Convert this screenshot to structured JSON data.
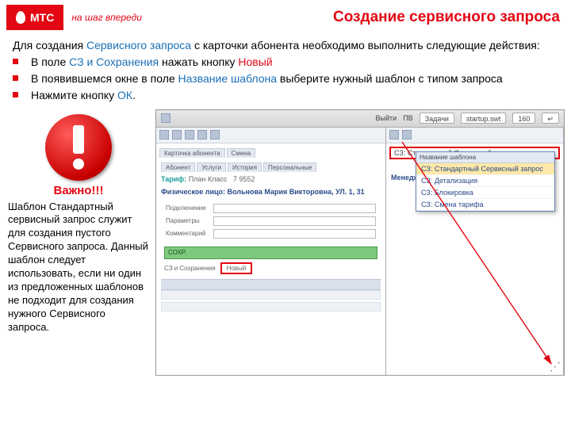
{
  "brand": {
    "name": "МТС",
    "slogan": "на шаг впереди"
  },
  "page_title": "Создание сервисного запроса",
  "intro": {
    "prefix": "Для создания ",
    "link": "Сервисного запроса",
    "suffix": " с карточки абонента необходимо выполнить следующие действия:"
  },
  "bullets": [
    {
      "t1": "В поле ",
      "b1": "СЗ и Сохранения",
      "t2": " нажать кнопку ",
      "r1": "Новый"
    },
    {
      "t1": "В появившемся окне в поле ",
      "b1": "Название шаблона",
      "t2": " выберите нужный шаблон с типом запроса"
    },
    {
      "t1": "Нажмите кнопку ",
      "b1": "ОК",
      "t2": "."
    }
  ],
  "warning": {
    "title": "Важно!!!",
    "prefix": "Шаблон ",
    "template_name": "Стандартный сервисный запрос",
    "suffix": " служит для создания пустого Сервисного запроса. Данный шаблон следует использовать, если ни один из предложенных шаблонов не подходит для создания нужного Сервисного запроса."
  },
  "screenshot": {
    "top_right_items": [
      "Выйти",
      "ПВ",
      "Задачи",
      "160"
    ],
    "startup_field": "startup.swt",
    "go_btn": "↵",
    "left_tabs": [
      "Карточка абонента",
      "Смена"
    ],
    "sub_tabs": [
      "Абонент",
      "Услуги",
      "История",
      "Персональные"
    ],
    "tariff_label": "Тариф: ",
    "tariff_value": "План Класс",
    "msisdn": "7 9552",
    "header_line": "Физическое лицо: Вольнова Мария Викторовна, УЛ. 1, 31",
    "manager_label": "Менеджер: ",
    "form_labels": [
      "Подключение",
      "Параметры",
      "Комментарий"
    ],
    "saved_label": "СОХР.",
    "section_label": "СЗ и Сохранения",
    "new_btn": "Новый",
    "dropdown_header": "Название шаблона",
    "dropdown_items": [
      "СЗ: Стандартный Сервисный запрос",
      "СЗ: Детализация",
      "СЗ: Блокировка",
      "СЗ: Смена тарифа"
    ]
  }
}
